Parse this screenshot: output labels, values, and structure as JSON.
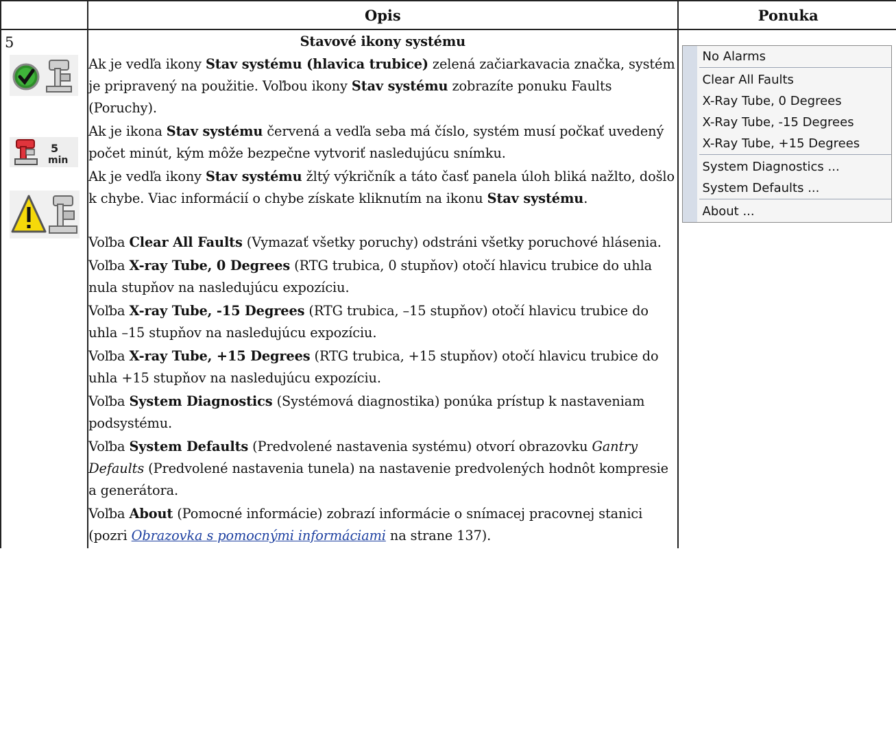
{
  "header": {
    "col_opis": "Opis",
    "col_ponuka": "Ponuka"
  },
  "row": {
    "number": "5",
    "title": "Stavové ikony systému",
    "para1": {
      "a": "Ak je vedľa ikony ",
      "b": "Stav systému (hlavica trubice)",
      "c": " zelená začiarkavacia značka, systém je pripravený na použitie. Voľbou ikony ",
      "d": "Stav systému",
      "e": " zobrazíte ponuku Faults (Poruchy)."
    },
    "para2": {
      "a": "Ak je ikona ",
      "b": "Stav systému",
      "c": " červená a vedľa seba má číslo, systém musí počkať uvedený počet minút, kým môže bezpečne vytvoriť nasledujúcu snímku."
    },
    "para3": {
      "a": "Ak je vedľa ikony ",
      "b": "Stav systému",
      "c": " žltý výkričník a táto časť panela úloh bliká nažlto, došlo k chybe. Viac informácií o chybe získate kliknutím na ikonu ",
      "d": "Stav systému",
      "e": "."
    },
    "para4": {
      "a": "Voľba ",
      "b": "Clear All Faults",
      "c": " (Vymazať všetky poruchy) odstráni všetky poruchové hlásenia."
    },
    "para5": {
      "a": "Voľba ",
      "b": "X-ray Tube, 0 Degrees",
      "c": " (RTG trubica, 0 stupňov) otočí hlavicu trubice do uhla nula stupňov na nasledujúcu expozíciu."
    },
    "para6": {
      "a": "Voľba ",
      "b": "X-ray Tube, -15 Degrees",
      "c": " (RTG trubica, –15 stupňov) otočí hlavicu trubice do uhla –15 stupňov na nasledujúcu expozíciu."
    },
    "para7": {
      "a": "Voľba ",
      "b": "X-ray Tube, +15 Degrees",
      "c": " (RTG trubica, +15 stupňov) otočí hlavicu trubice do uhla +15 stupňov na nasledujúcu expozíciu."
    },
    "para8": {
      "a": "Voľba ",
      "b": "System Diagnostics",
      "c": " (Systémová diagnostika) ponúka prístup k nastaveniam podsystému."
    },
    "para9": {
      "a": "Voľba ",
      "b": "System Defaults",
      "c": " (Predvolené nastavenia systému) otvorí obrazovku ",
      "d": "Gantry Defaults",
      "e": " (Predvolené nastavenia tunela) na nastavenie predvolených hodnôt kompresie a generátora."
    },
    "para10": {
      "a": "Voľba ",
      "b": "About",
      "c": " (Pomocné informácie) zobrazí informácie o snímacej pracovnej stanici (pozri ",
      "link": "Obrazovka s pomocnými informáciami",
      "d": " na strane 137)."
    }
  },
  "icons": {
    "ready": "status-ready-icon",
    "wait": "status-wait-icon",
    "wait_label": "5",
    "wait_unit": "min",
    "error": "status-error-icon"
  },
  "menu": {
    "items": [
      "No Alarms",
      "Clear All Faults",
      "X-Ray Tube, 0 Degrees",
      "X-Ray Tube, -15 Degrees",
      "X-Ray Tube, +15 Degrees",
      "System Diagnostics ...",
      "System Defaults ...",
      "About ..."
    ]
  },
  "colors": {
    "link": "#1c3fa0",
    "menu_bg": "#f5f5f5",
    "menu_bar": "#d6dde8"
  }
}
